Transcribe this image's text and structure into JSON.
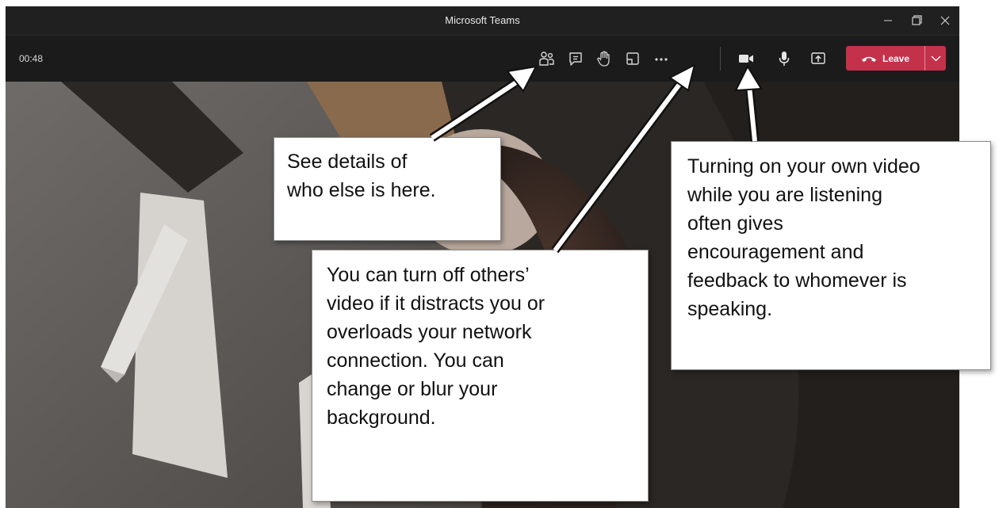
{
  "window": {
    "title": "Microsoft Teams",
    "controls": [
      "minimize-icon",
      "restore-icon",
      "close-icon"
    ]
  },
  "toolbar": {
    "timer": "00:48",
    "icons": [
      "participants-icon",
      "chat-icon",
      "raise-hand-icon",
      "breakout-icon",
      "more-options-icon",
      "camera-icon",
      "microphone-icon",
      "share-screen-icon"
    ],
    "leave_label": "Leave",
    "leave_color": "#c4314b"
  },
  "callouts": {
    "participants": {
      "lines": [
        "See details of",
        "who else is here."
      ]
    },
    "more_options": {
      "lines": [
        "You can turn off others’",
        "video if it distracts you or",
        "overloads your network",
        "connection. You can",
        "change or blur your",
        "background."
      ]
    },
    "camera": {
      "lines": [
        "Turning on your own video",
        "while you are listening",
        "often gives",
        "encouragement and",
        "feedback to whomever is",
        "speaking."
      ]
    }
  }
}
